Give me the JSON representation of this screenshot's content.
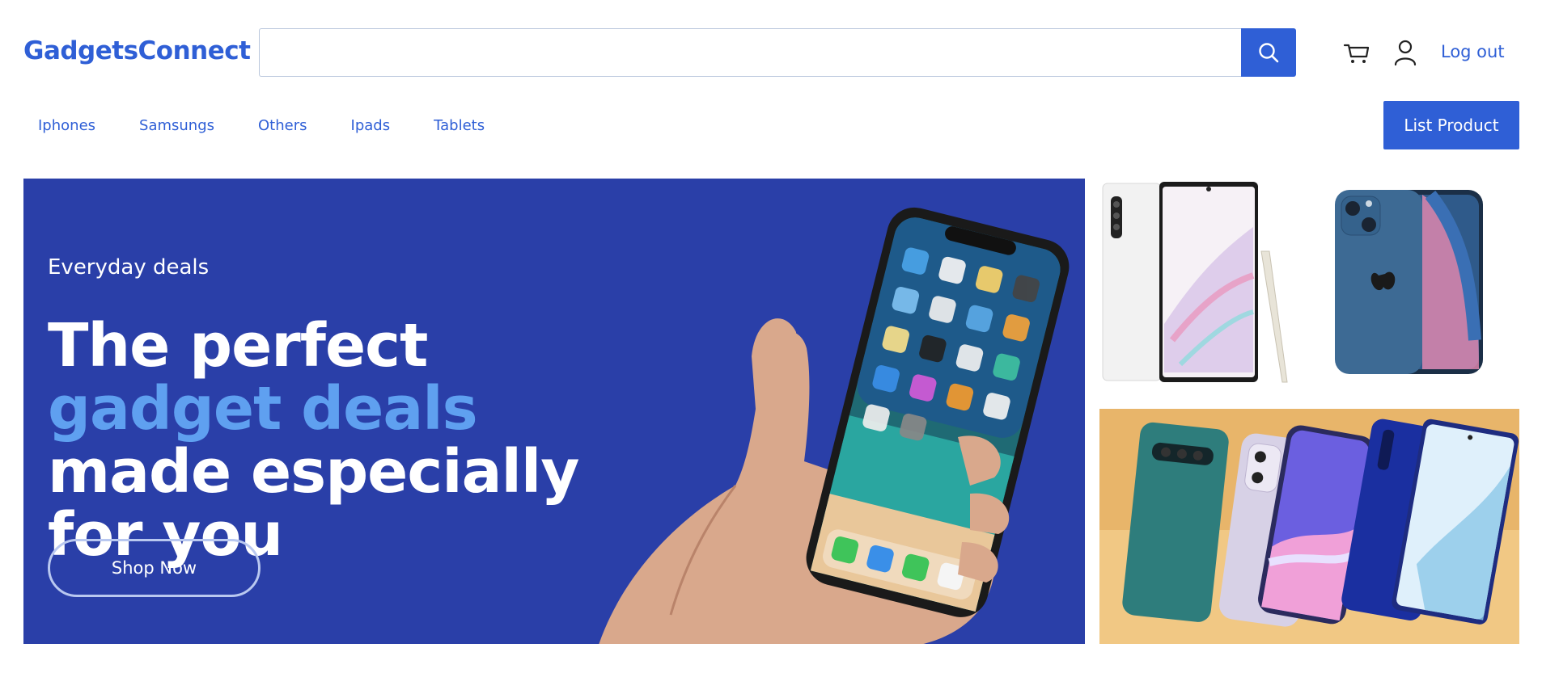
{
  "header": {
    "logo": "GadgetsConnect",
    "search_placeholder": "",
    "logout_label": "Log out"
  },
  "nav": {
    "items": [
      "Iphones",
      "Samsungs",
      "Others",
      "Ipads",
      "Tablets"
    ],
    "list_product_label": "List Product"
  },
  "hero": {
    "eyebrow": "Everyday deals",
    "headline_part1": "The perfect ",
    "headline_accent": "gadget deals",
    "headline_part2": " made especially for you",
    "cta_label": "Shop Now"
  },
  "colors": {
    "brand": "#2f5fd6",
    "hero_bg": "#2a3fa8",
    "accent_text": "#5fa0f0",
    "promo_bg": "#e8b56a"
  },
  "icons": [
    "search-icon",
    "cart-icon",
    "user-icon"
  ]
}
